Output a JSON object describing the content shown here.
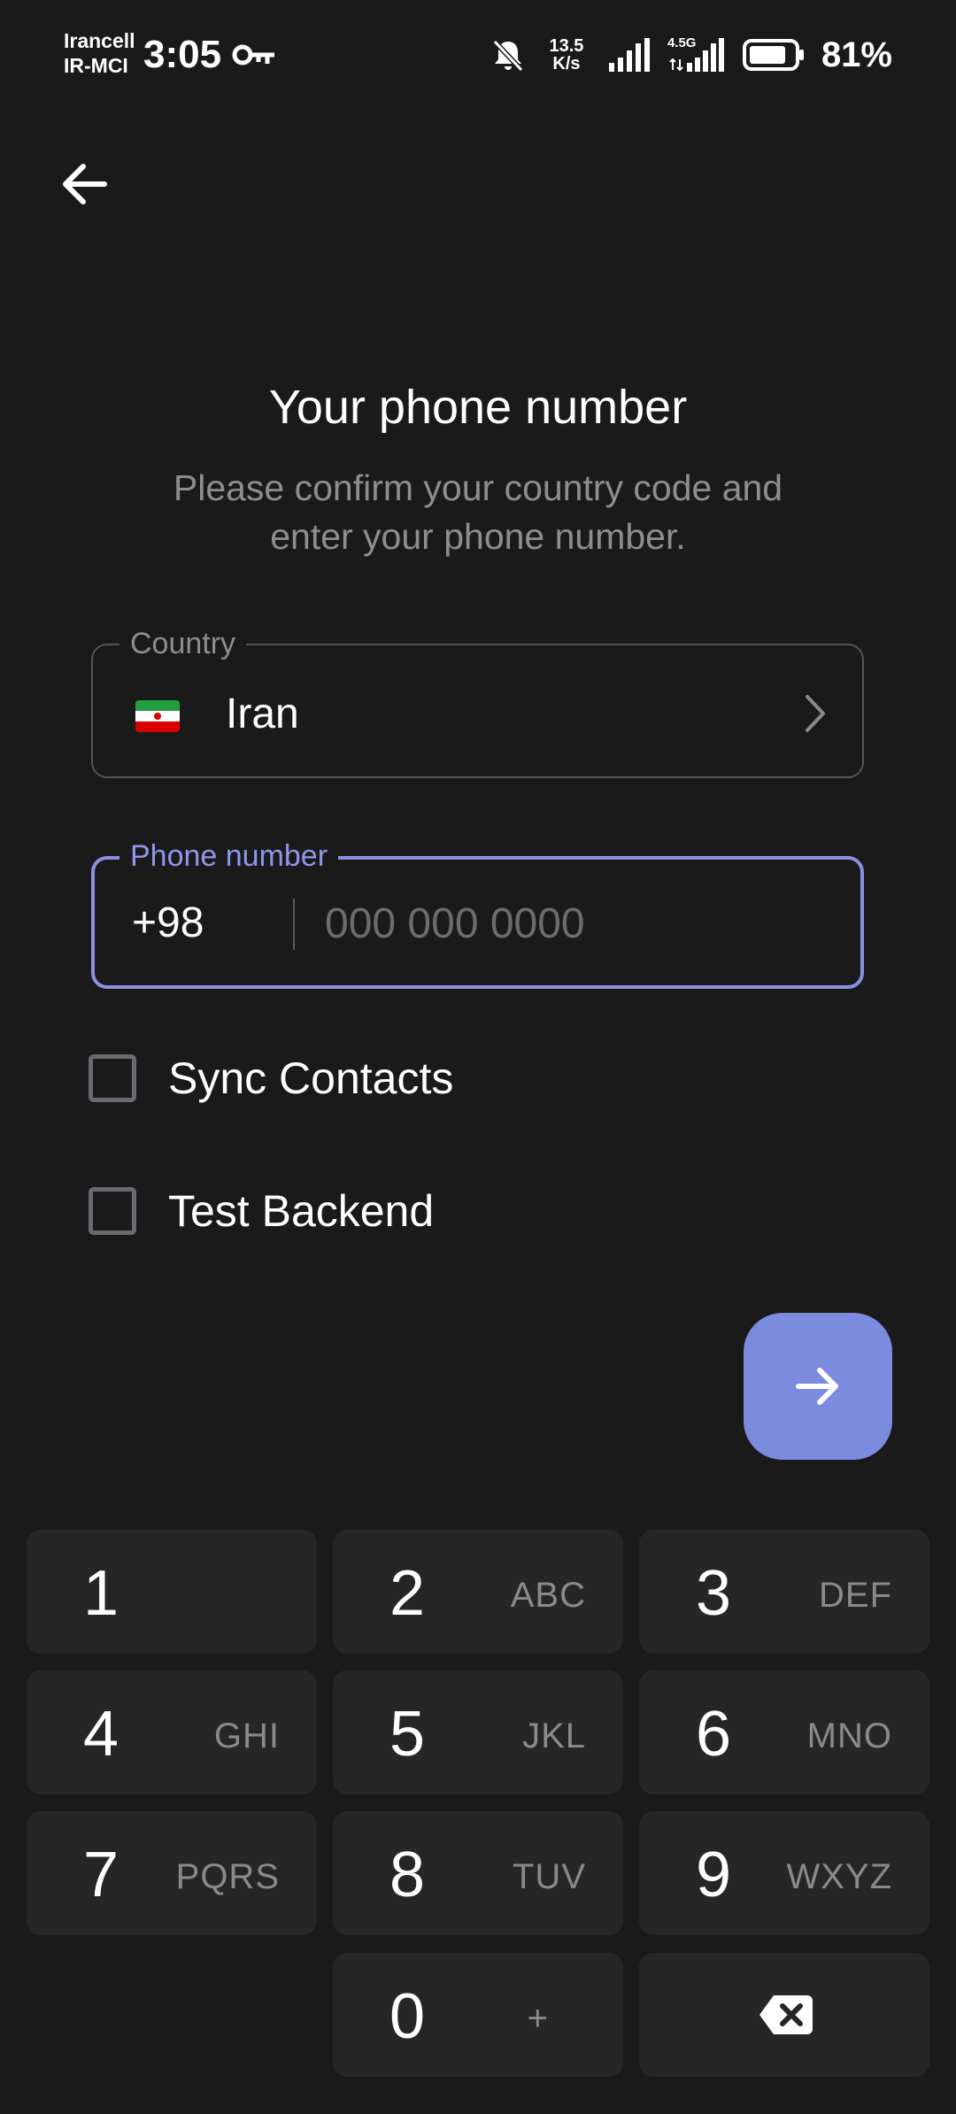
{
  "status_bar": {
    "carrier_line1": "Irancell",
    "carrier_line2": "IR-MCI",
    "time": "3:05",
    "net_speed_value": "13.5",
    "net_speed_unit": "K/s",
    "lte_label": "4.5G",
    "battery": "81%",
    "icons": [
      "vpn-key-icon",
      "mute-icon",
      "signal-icon",
      "lte-signal-icon",
      "battery-icon"
    ]
  },
  "nav": {
    "back_icon": "arrow-left-icon"
  },
  "header": {
    "title": "Your phone number",
    "subtitle": "Please confirm your country code and enter your phone number."
  },
  "country": {
    "label": "Country",
    "value": "Iran",
    "flag": "iran-flag-icon",
    "chevron": "chevron-right-icon"
  },
  "phone": {
    "label": "Phone number",
    "code": "+98",
    "value": "",
    "placeholder": "000 000 0000"
  },
  "options": {
    "sync_contacts": {
      "label": "Sync Contacts",
      "checked": false
    },
    "test_backend": {
      "label": "Test Backend",
      "checked": false
    }
  },
  "next_button": {
    "icon": "arrow-right-icon"
  },
  "keypad": {
    "keys": [
      {
        "digit": "1",
        "letters": ""
      },
      {
        "digit": "2",
        "letters": "ABC"
      },
      {
        "digit": "3",
        "letters": "DEF"
      },
      {
        "digit": "4",
        "letters": "GHI"
      },
      {
        "digit": "5",
        "letters": "JKL"
      },
      {
        "digit": "6",
        "letters": "MNO"
      },
      {
        "digit": "7",
        "letters": "PQRS"
      },
      {
        "digit": "8",
        "letters": "TUV"
      },
      {
        "digit": "9",
        "letters": "WXYZ"
      },
      {
        "digit": "0",
        "letters": "+"
      }
    ],
    "backspace_icon": "backspace-icon"
  },
  "colors": {
    "background": "#1a1a1a",
    "accent": "#8891e0",
    "fab": "#7b8cde",
    "key": "#262626",
    "muted_text": "#8e8e8e"
  }
}
